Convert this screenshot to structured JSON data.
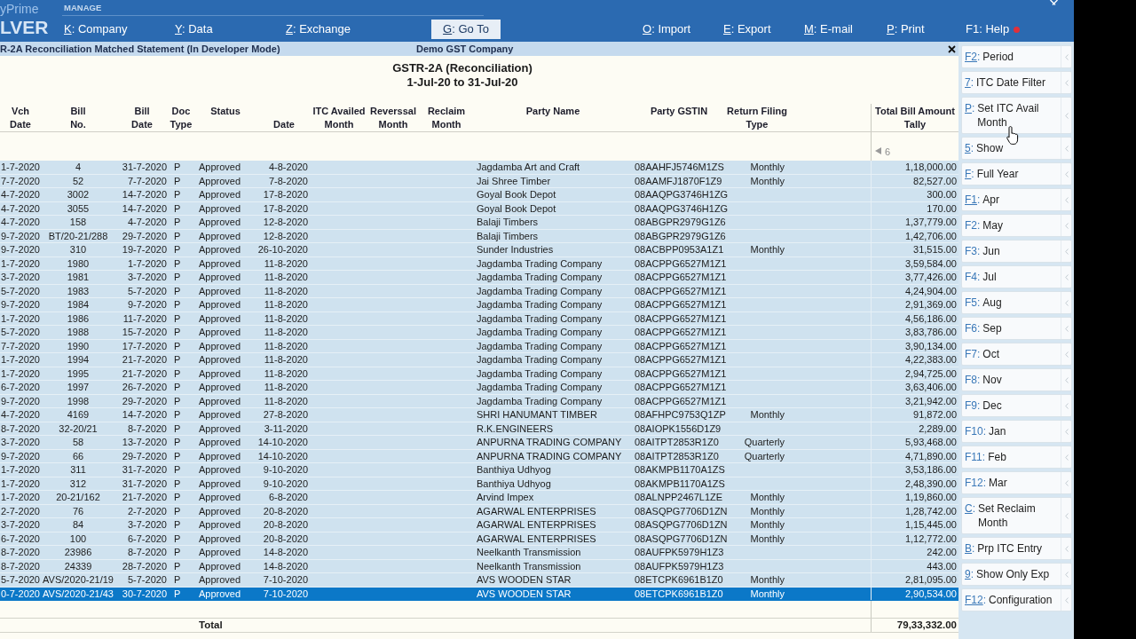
{
  "brand": {
    "top": "yPrime",
    "bottom": "LVER"
  },
  "menu": {
    "section": "MANAGE",
    "items": [
      {
        "key": "K:",
        "label": "Company",
        "underlined": true,
        "selected": false,
        "alert": false
      },
      {
        "key": "Y:",
        "label": "Data",
        "underlined": true,
        "selected": false,
        "alert": false
      },
      {
        "key": "Z:",
        "label": "Exchange",
        "underlined": true,
        "selected": false,
        "alert": false
      },
      {
        "key": "G:",
        "label": "Go To",
        "underlined": true,
        "selected": true,
        "alert": false
      },
      {
        "key": "O:",
        "label": "Import",
        "underlined": true,
        "selected": false,
        "alert": false
      },
      {
        "key": "E:",
        "label": "Export",
        "underlined": true,
        "selected": false,
        "alert": false
      },
      {
        "key": "M:",
        "label": "E-mail",
        "underlined": true,
        "selected": false,
        "alert": false
      },
      {
        "key": "P:",
        "label": "Print",
        "underlined": true,
        "selected": false,
        "alert": false
      },
      {
        "key": "F1:",
        "label": "Help",
        "underlined": false,
        "selected": false,
        "alert": true
      }
    ]
  },
  "title_bar": {
    "report_name": "R-2A Reconciliation Matched Statement (In Developer Mode)",
    "company": "Demo GST Company"
  },
  "report": {
    "heading": "GSTR-2A (Reconciliation)",
    "period": "1-Jul-20 to 31-Jul-20"
  },
  "table": {
    "columns": [
      {
        "top": "Vch",
        "bottom": "Date"
      },
      {
        "top": "Bill",
        "bottom": "No."
      },
      {
        "top": "Bill",
        "bottom": "Date"
      },
      {
        "top": "Doc",
        "bottom": "Type"
      },
      {
        "top": "Status"
      },
      {
        "bottom": "Date"
      },
      {
        "top": "ITC Availed",
        "bottom": "Month"
      },
      {
        "top": "Reverssal",
        "bottom": "Month"
      },
      {
        "top": "Reclaim",
        "bottom": "Month"
      },
      {
        "top": "Party Name"
      },
      {
        "top": "Party GSTIN"
      },
      {
        "top": "Return Filing",
        "bottom": "Type"
      },
      {
        "top": "Total Bill Amount",
        "bottom": "Tally"
      }
    ],
    "page_indicator": "6",
    "rows": [
      {
        "vch_date": "1-7-2020",
        "bill_no": "4",
        "bill_date": "31-7-2020",
        "doc_type": "P",
        "status": "Approved",
        "date": "4-8-2020",
        "party_name": "Jagdamba Art and Craft",
        "party_gstin": "08AAHFJ5746M1ZS",
        "return_filing_type": "Monthly",
        "total_bill_amount": "1,18,000.00",
        "selected": false
      },
      {
        "vch_date": "7-7-2020",
        "bill_no": "52",
        "bill_date": "7-7-2020",
        "doc_type": "P",
        "status": "Approved",
        "date": "7-8-2020",
        "party_name": "Jai Shree Timber",
        "party_gstin": "08AAMFJ1870F1Z9",
        "return_filing_type": "Monthly",
        "total_bill_amount": "82,527.00",
        "selected": false
      },
      {
        "vch_date": "4-7-2020",
        "bill_no": "3002",
        "bill_date": "14-7-2020",
        "doc_type": "P",
        "status": "Approved",
        "date": "17-8-2020",
        "party_name": "Goyal Book Depot",
        "party_gstin": "08AAQPG3746H1ZG",
        "total_bill_amount": "300.00",
        "selected": false
      },
      {
        "vch_date": "4-7-2020",
        "bill_no": "3055",
        "bill_date": "14-7-2020",
        "doc_type": "P",
        "status": "Approved",
        "date": "17-8-2020",
        "party_name": "Goyal Book Depot",
        "party_gstin": "08AAQPG3746H1ZG",
        "total_bill_amount": "170.00",
        "selected": false
      },
      {
        "vch_date": "4-7-2020",
        "bill_no": "158",
        "bill_date": "4-7-2020",
        "doc_type": "P",
        "status": "Approved",
        "date": "12-8-2020",
        "party_name": "Balaji Timbers",
        "party_gstin": "08ABGPR2979G1Z6",
        "total_bill_amount": "1,37,779.00",
        "selected": false
      },
      {
        "vch_date": "9-7-2020",
        "bill_no": "BT/20-21/288",
        "bill_date": "29-7-2020",
        "doc_type": "P",
        "status": "Approved",
        "date": "12-8-2020",
        "party_name": "Balaji Timbers",
        "party_gstin": "08ABGPR2979G1Z6",
        "total_bill_amount": "1,42,706.00",
        "selected": false
      },
      {
        "vch_date": "9-7-2020",
        "bill_no": "310",
        "bill_date": "19-7-2020",
        "doc_type": "P",
        "status": "Approved",
        "date": "26-10-2020",
        "party_name": "Sunder Industries",
        "party_gstin": "08ACBPP0953A1Z1",
        "return_filing_type": "Monthly",
        "total_bill_amount": "31,515.00",
        "selected": false
      },
      {
        "vch_date": "1-7-2020",
        "bill_no": "1980",
        "bill_date": "1-7-2020",
        "doc_type": "P",
        "status": "Approved",
        "date": "11-8-2020",
        "party_name": "Jagdamba Trading Company",
        "party_gstin": "08ACPPG6527M1Z1",
        "total_bill_amount": "3,59,584.00",
        "selected": false
      },
      {
        "vch_date": "3-7-2020",
        "bill_no": "1981",
        "bill_date": "3-7-2020",
        "doc_type": "P",
        "status": "Approved",
        "date": "11-8-2020",
        "party_name": "Jagdamba Trading Company",
        "party_gstin": "08ACPPG6527M1Z1",
        "total_bill_amount": "3,77,426.00",
        "selected": false
      },
      {
        "vch_date": "5-7-2020",
        "bill_no": "1983",
        "bill_date": "5-7-2020",
        "doc_type": "P",
        "status": "Approved",
        "date": "11-8-2020",
        "party_name": "Jagdamba Trading Company",
        "party_gstin": "08ACPPG6527M1Z1",
        "total_bill_amount": "4,24,904.00",
        "selected": false
      },
      {
        "vch_date": "9-7-2020",
        "bill_no": "1984",
        "bill_date": "9-7-2020",
        "doc_type": "P",
        "status": "Approved",
        "date": "11-8-2020",
        "party_name": "Jagdamba Trading Company",
        "party_gstin": "08ACPPG6527M1Z1",
        "total_bill_amount": "2,91,369.00",
        "selected": false
      },
      {
        "vch_date": "1-7-2020",
        "bill_no": "1986",
        "bill_date": "11-7-2020",
        "doc_type": "P",
        "status": "Approved",
        "date": "11-8-2020",
        "party_name": "Jagdamba Trading Company",
        "party_gstin": "08ACPPG6527M1Z1",
        "total_bill_amount": "4,56,186.00",
        "selected": false
      },
      {
        "vch_date": "5-7-2020",
        "bill_no": "1988",
        "bill_date": "15-7-2020",
        "doc_type": "P",
        "status": "Approved",
        "date": "11-8-2020",
        "party_name": "Jagdamba Trading Company",
        "party_gstin": "08ACPPG6527M1Z1",
        "total_bill_amount": "3,83,786.00",
        "selected": false
      },
      {
        "vch_date": "7-7-2020",
        "bill_no": "1990",
        "bill_date": "17-7-2020",
        "doc_type": "P",
        "status": "Approved",
        "date": "11-8-2020",
        "party_name": "Jagdamba Trading Company",
        "party_gstin": "08ACPPG6527M1Z1",
        "total_bill_amount": "3,90,134.00",
        "selected": false
      },
      {
        "vch_date": "1-7-2020",
        "bill_no": "1994",
        "bill_date": "21-7-2020",
        "doc_type": "P",
        "status": "Approved",
        "date": "11-8-2020",
        "party_name": "Jagdamba Trading Company",
        "party_gstin": "08ACPPG6527M1Z1",
        "total_bill_amount": "4,22,383.00",
        "selected": false
      },
      {
        "vch_date": "1-7-2020",
        "bill_no": "1995",
        "bill_date": "21-7-2020",
        "doc_type": "P",
        "status": "Approved",
        "date": "11-8-2020",
        "party_name": "Jagdamba Trading Company",
        "party_gstin": "08ACPPG6527M1Z1",
        "total_bill_amount": "2,94,725.00",
        "selected": false
      },
      {
        "vch_date": "6-7-2020",
        "bill_no": "1997",
        "bill_date": "26-7-2020",
        "doc_type": "P",
        "status": "Approved",
        "date": "11-8-2020",
        "party_name": "Jagdamba Trading Company",
        "party_gstin": "08ACPPG6527M1Z1",
        "total_bill_amount": "3,63,406.00",
        "selected": false
      },
      {
        "vch_date": "9-7-2020",
        "bill_no": "1998",
        "bill_date": "29-7-2020",
        "doc_type": "P",
        "status": "Approved",
        "date": "11-8-2020",
        "party_name": "Jagdamba Trading Company",
        "party_gstin": "08ACPPG6527M1Z1",
        "total_bill_amount": "3,21,942.00",
        "selected": false
      },
      {
        "vch_date": "4-7-2020",
        "bill_no": "4169",
        "bill_date": "14-7-2020",
        "doc_type": "P",
        "status": "Approved",
        "date": "27-8-2020",
        "party_name": "SHRI HANUMANT TIMBER",
        "party_gstin": "08AFHPC9753Q1ZP",
        "return_filing_type": "Monthly",
        "total_bill_amount": "91,872.00",
        "selected": false
      },
      {
        "vch_date": "8-7-2020",
        "bill_no": "32-20/21",
        "bill_date": "8-7-2020",
        "doc_type": "P",
        "status": "Approved",
        "date": "3-11-2020",
        "party_name": "R.K.ENGINEERS",
        "party_gstin": "08AIOPK1556D1Z9",
        "total_bill_amount": "2,289.00",
        "selected": false
      },
      {
        "vch_date": "3-7-2020",
        "bill_no": "58",
        "bill_date": "13-7-2020",
        "doc_type": "P",
        "status": "Approved",
        "date": "14-10-2020",
        "party_name": "ANPURNA TRADING COMPANY",
        "party_gstin": "08AITPT2853R1Z0",
        "return_filing_type": "Quarterly",
        "total_bill_amount": "5,93,468.00",
        "selected": false
      },
      {
        "vch_date": "9-7-2020",
        "bill_no": "66",
        "bill_date": "29-7-2020",
        "doc_type": "P",
        "status": "Approved",
        "date": "14-10-2020",
        "party_name": "ANPURNA TRADING COMPANY",
        "party_gstin": "08AITPT2853R1Z0",
        "return_filing_type": "Quarterly",
        "total_bill_amount": "4,71,890.00",
        "selected": false
      },
      {
        "vch_date": "1-7-2020",
        "bill_no": "311",
        "bill_date": "31-7-2020",
        "doc_type": "P",
        "status": "Approved",
        "date": "9-10-2020",
        "party_name": "Banthiya Udhyog",
        "party_gstin": "08AKMPB1170A1ZS",
        "total_bill_amount": "3,53,186.00",
        "selected": false
      },
      {
        "vch_date": "1-7-2020",
        "bill_no": "312",
        "bill_date": "31-7-2020",
        "doc_type": "P",
        "status": "Approved",
        "date": "9-10-2020",
        "party_name": "Banthiya Udhyog",
        "party_gstin": "08AKMPB1170A1ZS",
        "total_bill_amount": "2,48,390.00",
        "selected": false
      },
      {
        "vch_date": "1-7-2020",
        "bill_no": "20-21/162",
        "bill_date": "21-7-2020",
        "doc_type": "P",
        "status": "Approved",
        "date": "6-8-2020",
        "party_name": "Arvind Impex",
        "party_gstin": "08ALNPP2467L1ZE",
        "return_filing_type": "Monthly",
        "total_bill_amount": "1,19,860.00",
        "selected": false
      },
      {
        "vch_date": "2-7-2020",
        "bill_no": "76",
        "bill_date": "2-7-2020",
        "doc_type": "P",
        "status": "Approved",
        "date": "20-8-2020",
        "party_name": "AGARWAL ENTERPRISES",
        "party_gstin": "08ASQPG7706D1ZN",
        "return_filing_type": "Monthly",
        "total_bill_amount": "1,28,742.00",
        "selected": false
      },
      {
        "vch_date": "3-7-2020",
        "bill_no": "84",
        "bill_date": "3-7-2020",
        "doc_type": "P",
        "status": "Approved",
        "date": "20-8-2020",
        "party_name": "AGARWAL ENTERPRISES",
        "party_gstin": "08ASQPG7706D1ZN",
        "return_filing_type": "Monthly",
        "total_bill_amount": "1,15,445.00",
        "selected": false
      },
      {
        "vch_date": "6-7-2020",
        "bill_no": "100",
        "bill_date": "6-7-2020",
        "doc_type": "P",
        "status": "Approved",
        "date": "20-8-2020",
        "party_name": "AGARWAL ENTERPRISES",
        "party_gstin": "08ASQPG7706D1ZN",
        "return_filing_type": "Monthly",
        "total_bill_amount": "1,12,772.00",
        "selected": false
      },
      {
        "vch_date": "8-7-2020",
        "bill_no": "23986",
        "bill_date": "8-7-2020",
        "doc_type": "P",
        "status": "Approved",
        "date": "14-8-2020",
        "party_name": "Neelkanth Transmission",
        "party_gstin": "08AUFPK5979H1Z3",
        "total_bill_amount": "242.00",
        "selected": false
      },
      {
        "vch_date": "8-7-2020",
        "bill_no": "24339",
        "bill_date": "28-7-2020",
        "doc_type": "P",
        "status": "Approved",
        "date": "14-8-2020",
        "party_name": "Neelkanth Transmission",
        "party_gstin": "08AUFPK5979H1Z3",
        "total_bill_amount": "443.00",
        "selected": false
      },
      {
        "vch_date": "5-7-2020",
        "bill_no": "AVS/2020-21/19",
        "bill_date": "5-7-2020",
        "doc_type": "P",
        "status": "Approved",
        "date": "7-10-2020",
        "party_name": "AVS WOODEN STAR",
        "party_gstin": "08ETCPK6961B1Z0",
        "return_filing_type": "Monthly",
        "total_bill_amount": "2,81,095.00",
        "selected": false
      },
      {
        "vch_date": "0-7-2020",
        "bill_no": "AVS/2020-21/43",
        "bill_date": "30-7-2020",
        "doc_type": "P",
        "status": "Approved",
        "date": "7-10-2020",
        "party_name": "AVS WOODEN STAR",
        "party_gstin": "08ETCPK6961B1Z0",
        "return_filing_type": "Monthly",
        "total_bill_amount": "2,90,534.00",
        "selected": true
      }
    ],
    "total": {
      "label": "Total",
      "amount": "79,33,332.00"
    }
  },
  "sidebar": {
    "buttons": [
      {
        "key": "F2:",
        "label": "Period",
        "underlined": true
      },
      {
        "key": "7:",
        "label": "ITC Date Filter",
        "underlined": true
      },
      {
        "key": "P:",
        "label": "Set ITC Avail Month",
        "underlined": true
      },
      {
        "key": "5:",
        "label": "Show",
        "underlined": true
      },
      {
        "key": "F:",
        "label": "Full Year",
        "underlined": true
      },
      {
        "key": "F1:",
        "label": "Apr",
        "underlined": true
      },
      {
        "key": "F2:",
        "label": "May",
        "underlined": false
      },
      {
        "key": "F3:",
        "label": "Jun",
        "underlined": false
      },
      {
        "key": "F4:",
        "label": "Jul",
        "underlined": false
      },
      {
        "key": "F5:",
        "label": "Aug",
        "underlined": false
      },
      {
        "key": "F6:",
        "label": "Sep",
        "underlined": false
      },
      {
        "key": "F7:",
        "label": "Oct",
        "underlined": false
      },
      {
        "key": "F8:",
        "label": "Nov",
        "underlined": false
      },
      {
        "key": "F9:",
        "label": "Dec",
        "underlined": false
      },
      {
        "key": "F10:",
        "label": "Jan",
        "underlined": false
      },
      {
        "key": "F11:",
        "label": "Feb",
        "underlined": false
      },
      {
        "key": "F12:",
        "label": "Mar",
        "underlined": false
      },
      {
        "key": "C:",
        "label": "Set Reclaim Month",
        "underlined": true
      },
      {
        "key": "B:",
        "label": "Prp ITC Entry",
        "underlined": true
      },
      {
        "key": "9:",
        "label": "Show Only Exp",
        "underlined": true
      },
      {
        "key": "F12:",
        "label": "Configuration",
        "underlined": true
      }
    ]
  }
}
